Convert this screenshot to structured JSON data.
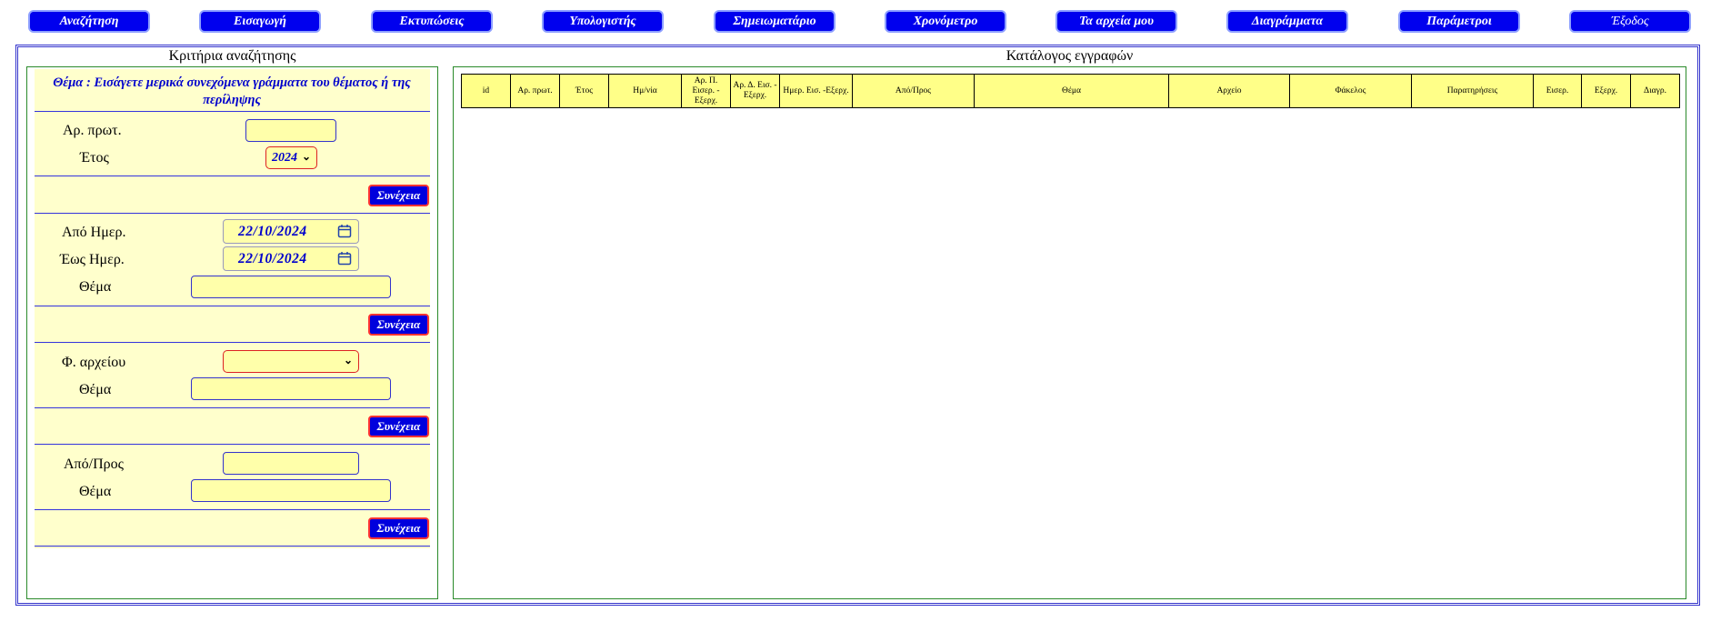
{
  "menu": [
    {
      "label": "Αναζήτηση"
    },
    {
      "label": "Εισαγωγή"
    },
    {
      "label": "Εκτυπώσεις"
    },
    {
      "label": "Υπολογιστής"
    },
    {
      "label": "Σημειωματάριο"
    },
    {
      "label": "Χρονόμετρο"
    },
    {
      "label": "Τα αρχεία μου"
    },
    {
      "label": "Διαγράμματα"
    },
    {
      "label": "Παράμετροι"
    },
    {
      "label": "Έξοδος"
    }
  ],
  "left_panel": {
    "title": "Κριτήρια αναζήτησης",
    "hint": "Θέμα : Εισάγετε μερικά συνεχόμενα γράμματα του θέματος ή της περίληψης",
    "section1": {
      "protocol_label": "Αρ. πρωτ.",
      "protocol_value": "",
      "year_label": "Έτος",
      "year_value": "2024",
      "continue": "Συνέχεια"
    },
    "section2": {
      "from_label": "Από Ημερ.",
      "from_value": "22/10/2024",
      "to_label": "Έως Ημερ.",
      "to_value": "22/10/2024",
      "subject_label": "Θέμα",
      "subject_value": "",
      "continue": "Συνέχεια"
    },
    "section3": {
      "folder_label": "Φ. αρχείου",
      "folder_value": "",
      "subject_label": "Θέμα",
      "subject_value": "",
      "continue": "Συνέχεια"
    },
    "section4": {
      "fromto_label": "Από/Προς",
      "fromto_value": "",
      "subject_label": "Θέμα",
      "subject_value": "",
      "continue": "Συνέχεια"
    }
  },
  "right_panel": {
    "title": "Κατάλογος εγγραφών",
    "columns": [
      "id",
      "Αρ. πρωτ.",
      "Έτος",
      "Ημ/νία",
      "Αρ. Π. Εισερ. - Εξερχ.",
      "Αρ. Δ. Εισ. - Εξερχ.",
      "Ημερ. Εισ. -Εξερχ.",
      "Από/Προς",
      "Θέμα",
      "Αρχείο",
      "Φάκελος",
      "Παρατηρήσεις",
      "Εισερ.",
      "Εξερχ.",
      "Διαγρ."
    ]
  },
  "colors": {
    "menu_button": "#0000ee",
    "panel_fill": "#ffffcc",
    "input_fill": "#ffffaa",
    "header_fill": "#ffff88",
    "frame_blue": "#3333cc",
    "panel_border_green": "#2a8a2a",
    "accent_red": "#dd2222"
  },
  "icons": {
    "calendar": "calendar-icon",
    "dropdown": "chevron-down-icon"
  }
}
